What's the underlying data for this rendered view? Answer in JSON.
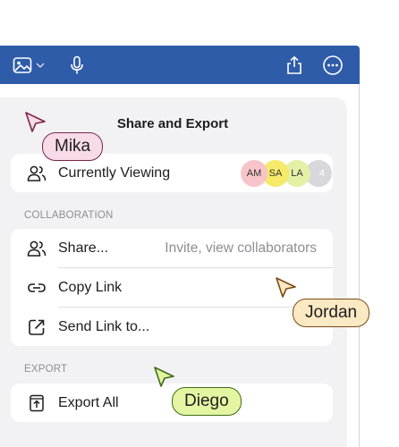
{
  "toolbar": {
    "icons": [
      "image-icon",
      "chevron-down-icon",
      "microphone-icon",
      "share-icon",
      "more-icon"
    ],
    "background": "#2e5ca8"
  },
  "popover": {
    "title": "Share and Export",
    "currently_viewing": {
      "label": "Currently Viewing",
      "avatars": [
        {
          "initials": "AM",
          "color": "#f7c5c9"
        },
        {
          "initials": "SA",
          "color": "#f5ea6a"
        },
        {
          "initials": "LA",
          "color": "#e3f0a6"
        },
        {
          "initials": "4",
          "color": "#d8d8dc"
        }
      ]
    },
    "collaboration": {
      "heading": "COLLABORATION",
      "share_label": "Share...",
      "share_sub": "Invite, view collaborators",
      "copy_link_label": "Copy Link",
      "send_link_label": "Send Link to..."
    },
    "export": {
      "heading": "EXPORT",
      "export_all_label": "Export All"
    }
  },
  "collaborators": [
    {
      "name": "Mika",
      "color": "#f8dbe8",
      "border": "#7a2448"
    },
    {
      "name": "Jordan",
      "color": "#fbe9c3",
      "border": "#7a4a12"
    },
    {
      "name": "Diego",
      "color": "#e4f5a2",
      "border": "#3f6b18"
    }
  ]
}
